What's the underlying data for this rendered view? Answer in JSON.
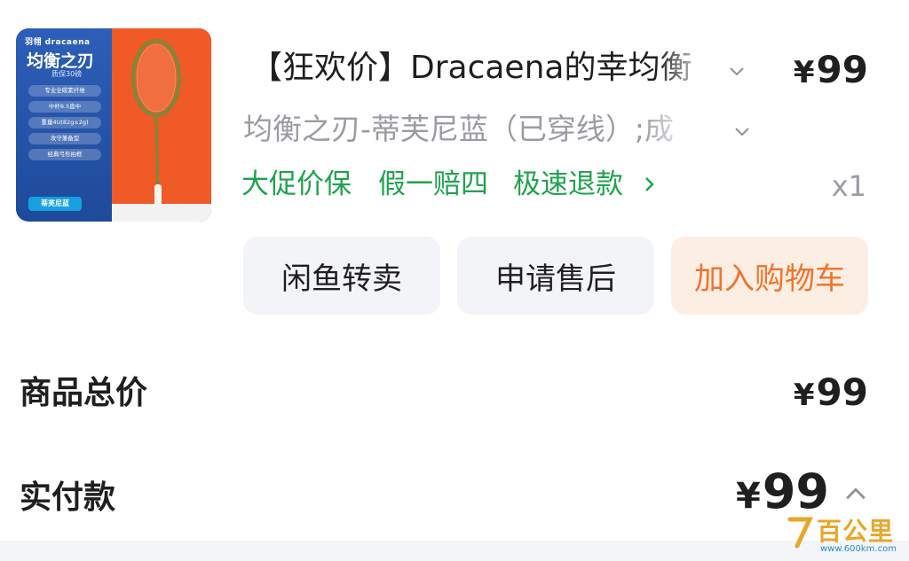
{
  "product": {
    "title": "【狂欢价】Dracaena的幸均衡",
    "price": "99",
    "currency": "¥",
    "spec": "均衡之刃-蒂芙尼蓝（已穿线）;成",
    "services": [
      "大促价保",
      "假一赔四",
      "极速退款"
    ],
    "quantity": "x1",
    "thumbnail": {
      "brand": "羽翎 dracaena",
      "name": "均衡之刃",
      "sub": "质保30磅",
      "features": [
        "专业全碳素纤维",
        "中杆6.5直中",
        "重量4U(82g±2g)",
        "攻守兼备型",
        "经典弓形拍框"
      ],
      "tag": "蒂芙尼蓝"
    }
  },
  "actions": {
    "resell": "闲鱼转卖",
    "after_sale": "申请售后",
    "add_cart": "加入购物车"
  },
  "summary": {
    "total_label": "商品总价",
    "total_price": "99",
    "paid_label": "实付款",
    "paid_price": "99"
  },
  "watermark": {
    "text": "百公里",
    "url": "www.600km.com"
  },
  "colors": {
    "service_green": "#1fa34e",
    "cart_orange": "#f0732c",
    "cart_bg": "#fdeee4",
    "secondary_text": "#9a9ca3"
  }
}
